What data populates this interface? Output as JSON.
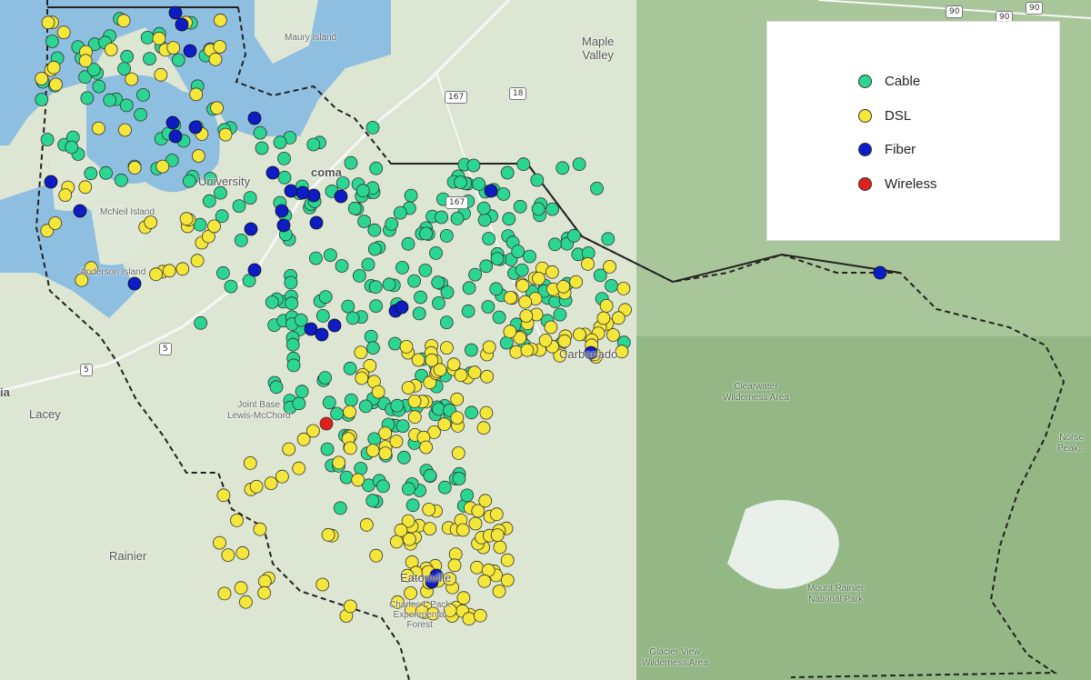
{
  "legend": {
    "items": [
      {
        "label": "Cable",
        "color": "#2bd693"
      },
      {
        "label": "DSL",
        "color": "#f5e63a"
      },
      {
        "label": "Fiber",
        "color": "#0d1cc4"
      },
      {
        "label": "Wireless",
        "color": "#e0201a"
      }
    ]
  },
  "places": {
    "maple_valley": "Maple\nValley",
    "maury_island": "Maury Island",
    "university_place": "University",
    "tacoma": "coma",
    "mcneil_island": "McNeil Island",
    "anderson_island": "Anderson Island",
    "carbonado": "Carbonado",
    "clearwater": "Clearwater\nWilderness Area",
    "lewis_mcchord": "Joint Base\nLewis-McChord",
    "lacey": "Lacey",
    "olympia": "ia",
    "rainier": "Rainier",
    "eatonville": "Eatonville",
    "pack_forest": "Charles L Pack\nExperimental\nForest",
    "mount_rainier": "Mount Rainier\nNational Park",
    "glacier_view": "Glacier View\nWilderness Area",
    "norse_peak": "Norse\nPeak..."
  },
  "roads": [
    "5",
    "5",
    "167",
    "18",
    "167",
    "90",
    "90",
    "90"
  ],
  "markers": {
    "cable_count": 305,
    "dsl_count": 250,
    "fiber_count": 30,
    "wireless_count": 1
  }
}
